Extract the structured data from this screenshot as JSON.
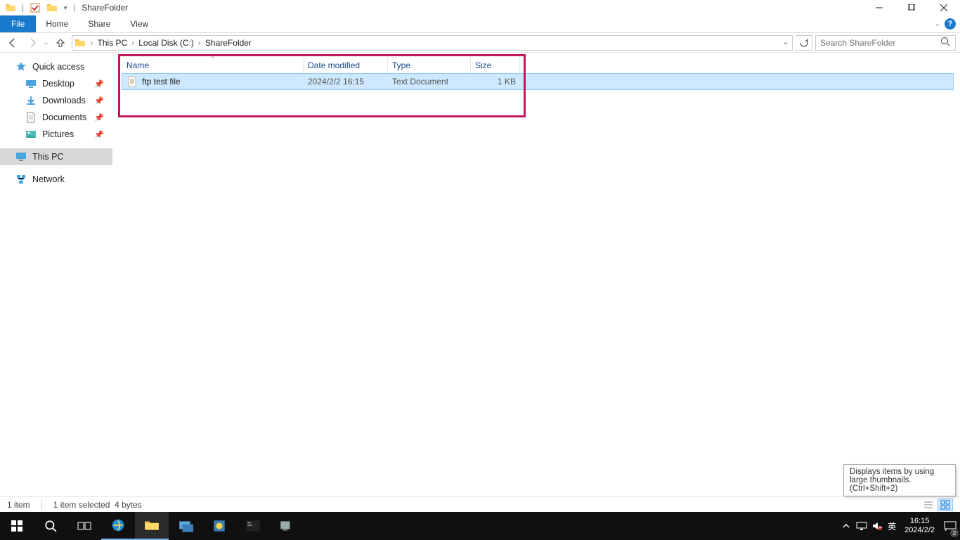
{
  "window": {
    "title": "ShareFolder"
  },
  "ribbon": {
    "file": "File",
    "tabs": [
      "Home",
      "Share",
      "View"
    ]
  },
  "breadcrumbs": [
    "This PC",
    "Local Disk (C:)",
    "ShareFolder"
  ],
  "search": {
    "placeholder": "Search ShareFolder"
  },
  "sidebar": {
    "quick_access": "Quick access",
    "items": [
      {
        "label": "Desktop",
        "pinned": true,
        "icon": "desktop"
      },
      {
        "label": "Downloads",
        "pinned": true,
        "icon": "downloads"
      },
      {
        "label": "Documents",
        "pinned": true,
        "icon": "documents"
      },
      {
        "label": "Pictures",
        "pinned": true,
        "icon": "pictures"
      }
    ],
    "this_pc": "This PC",
    "network": "Network"
  },
  "columns": {
    "name": "Name",
    "date": "Date modified",
    "type": "Type",
    "size": "Size"
  },
  "files": [
    {
      "name": "ftp test file",
      "date": "2024/2/2 16:15",
      "type": "Text Document",
      "size": "1 KB",
      "selected": true
    }
  ],
  "status": {
    "count": "1 item",
    "selected": "1 item selected",
    "bytes": "4 bytes"
  },
  "tooltip": "Displays items by using large thumbnails. (Ctrl+Shift+2)",
  "taskbar": {
    "ime": "英",
    "time": "16:15",
    "date": "2024/2/2",
    "notif_count": "2"
  }
}
